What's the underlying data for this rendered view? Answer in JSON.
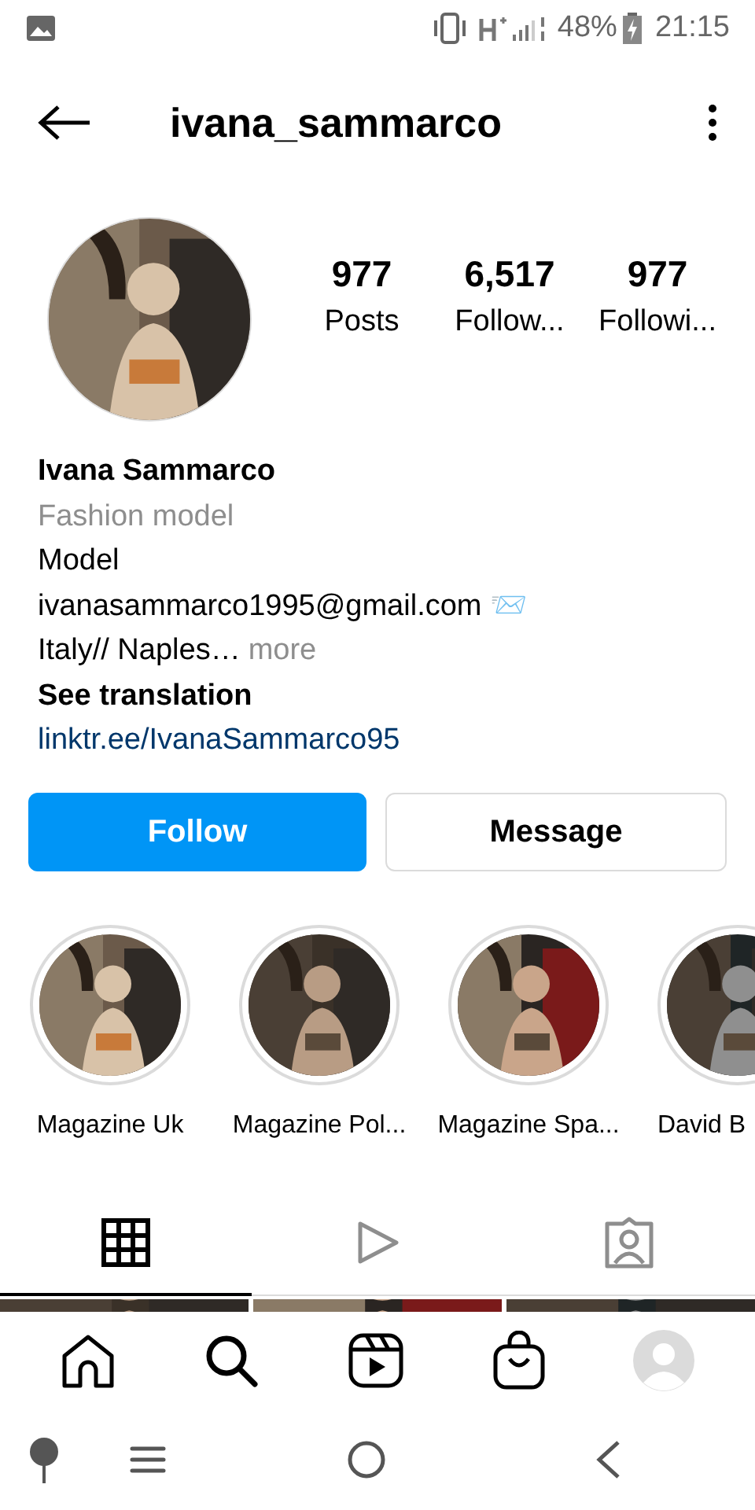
{
  "status_bar": {
    "battery": "48%",
    "time": "21:15"
  },
  "header": {
    "username": "ivana_sammarco"
  },
  "profile": {
    "stats": [
      {
        "value": "977",
        "label": "Posts"
      },
      {
        "value": "6,517",
        "label": "Follow..."
      },
      {
        "value": "977",
        "label": "Followi..."
      }
    ],
    "name": "Ivana Sammarco",
    "category": "Fashion model",
    "bio_lines": [
      "Model",
      "ivanasammarco1995@gmail.com 📨"
    ],
    "location": "Italy// Naples…",
    "more": "more",
    "see_translation": "See translation",
    "link": "linktr.ee/IvanaSammarco95"
  },
  "buttons": [
    {
      "kind": "primary",
      "label": "Follow"
    },
    {
      "kind": "secondary",
      "label": "Message"
    }
  ],
  "highlights": [
    {
      "label": "Magazine Uk"
    },
    {
      "label": "Magazine Pol..."
    },
    {
      "label": "Magazine Spa..."
    },
    {
      "label": "David B"
    }
  ],
  "tabs": [
    {
      "kind": "grid",
      "selected": true
    },
    {
      "kind": "reels",
      "selected": false
    },
    {
      "kind": "tagged",
      "selected": false
    }
  ],
  "bottom_nav": [
    {
      "kind": "home"
    },
    {
      "kind": "search"
    },
    {
      "kind": "reels"
    },
    {
      "kind": "shop"
    },
    {
      "kind": "profile"
    }
  ]
}
